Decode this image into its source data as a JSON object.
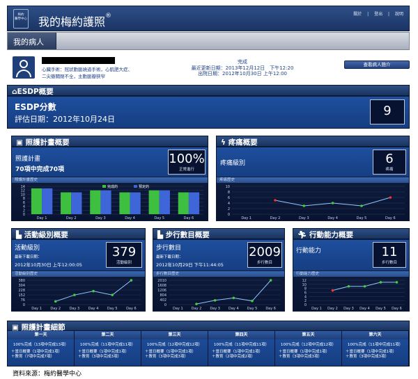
{
  "header": {
    "logo_text": "梅約\n醫學中心",
    "title": "我的梅約護照",
    "links": [
      "關於",
      "登出",
      "說明"
    ]
  },
  "nav": {
    "tab": "我的病人"
  },
  "patient": {
    "diagnosis_line1": "心臟手術：冠狀動脈繞道手術，心肌肥大症、",
    "diagnosis_line2": "二尖瓣關閉不全，主動脈瓣狹窄",
    "status": "完成",
    "last_update": "最近更新日期：2013年12月12日　下午12:20",
    "discharge": "出院日期：2012年10月30日 上午12:00",
    "view_button": "查看病人簡介"
  },
  "esdp": {
    "title": "ESDP概要",
    "score_label": "ESDP分數",
    "date": "評估日期：2012年10月24日",
    "score": "9"
  },
  "care_plan": {
    "title": "照護計畫概要",
    "label": "照護計畫",
    "summary": "70項中完成70項",
    "pct": "100%",
    "pct_caption": "正常進行",
    "history_label": "照護計畫歷史",
    "legend_done": "完成的",
    "legend_planned": "預定的",
    "chart_data": {
      "type": "bar",
      "categories": [
        "Day 1",
        "Day 2",
        "Day 3",
        "Day 4",
        "Day 5",
        "Day 6"
      ],
      "series": [
        {
          "name": "完成的",
          "values": [
            13,
            11,
            12,
            11,
            12,
            11
          ]
        },
        {
          "name": "預定的",
          "values": [
            13,
            11,
            12,
            11,
            12,
            11
          ]
        }
      ],
      "ylim": [
        0,
        14
      ],
      "yticks": [
        "14",
        "12",
        "10",
        "8",
        "6",
        "4",
        "2",
        "0"
      ],
      "colors": [
        "#3fbf3f",
        "#3f66d9"
      ]
    }
  },
  "pain": {
    "title": "疼痛概要",
    "label": "疼痛級別",
    "value": "6",
    "caption": "疼痛",
    "history_label": "疼痛歷史",
    "chart_data": {
      "type": "line",
      "categories": [
        "Day 1",
        "Day 2",
        "Day 3",
        "Day 4",
        "Day 5",
        "Day 6"
      ],
      "values": [
        null,
        5,
        3,
        4,
        3,
        6
      ],
      "ylim": [
        0,
        10
      ],
      "yticks": [
        "10",
        "8",
        "6",
        "4",
        "2",
        "0"
      ]
    }
  },
  "activity": {
    "title": "活動級別概要",
    "label": "活動級別",
    "latest": "最新下載日期：",
    "latest_date": "2012年10月30日 上午12:00:05",
    "value": "379",
    "caption": "活動級別",
    "history_label": "活動級別歷史",
    "chart_data": {
      "type": "line",
      "categories": [
        "Day 1",
        "Day 2",
        "Day 3",
        "Day 4",
        "Day 5",
        "Day 6"
      ],
      "values": [
        null,
        50,
        150,
        210,
        150,
        379
      ],
      "ylim": [
        0,
        380
      ],
      "yticks": [
        "380",
        "304",
        "228",
        "152",
        "76",
        "0"
      ]
    }
  },
  "steps": {
    "title": "步行數目概要",
    "label": "步行數目",
    "latest": "最新下載日期：",
    "latest_date": "2012年10月29日 下午11:44:05",
    "value": "2009",
    "caption": "步行數目",
    "history_label": "步行數目歷史",
    "chart_data": {
      "type": "line",
      "categories": [
        "Day 1",
        "Day 2",
        "Day 3",
        "Day 4",
        "Day 5",
        "Day 6"
      ],
      "values": [
        null,
        50,
        350,
        550,
        300,
        2009
      ],
      "ylim": [
        0,
        2010
      ],
      "yticks": [
        "2010",
        "1608",
        "1206",
        "804",
        "402",
        "0"
      ]
    }
  },
  "mobility": {
    "title": "行動能力概要",
    "label": "行動能力",
    "value": "11",
    "caption": "步行數目",
    "history_label": "行動能力歷史",
    "chart_data": {
      "type": "line",
      "categories": [
        "Day 1",
        "Day 2",
        "Day 3",
        "Day 4",
        "Day 5",
        "Day 6"
      ],
      "values": [
        null,
        7,
        9,
        9,
        11,
        11
      ],
      "ylim": [
        0,
        12
      ],
      "yticks": [
        "12",
        "10",
        "8",
        "6",
        "4",
        "2",
        "0"
      ]
    }
  },
  "details": {
    "title": "照護計畫細節",
    "days": [
      {
        "name": "第一天",
        "summary": "100%完成（13項中完成13項）",
        "l1": "＋當日概要（1項中完成1項）",
        "l2": "＋教育（7項中完成7項）"
      },
      {
        "name": "第二天",
        "summary": "100%完成（11項中完成11項）",
        "l1": "＋當日概要（1項中完成1項）",
        "l2": "＋教育（3項中完成3項）"
      },
      {
        "name": "第三天",
        "summary": "100%完成（12項中完成12項）",
        "l1": "＋當日概要（1項中完成1項）",
        "l2": "＋教育（3項中完成3項）"
      },
      {
        "name": "第四天",
        "summary": "100%完成（11項中完成11項）",
        "l1": "＋當日概要（1項中完成1項）",
        "l2": "＋教育（2項中完成2項）"
      },
      {
        "name": "第五天",
        "summary": "100%完成（12項中完成12項）",
        "l1": "＋當日概要（1項中完成1項）",
        "l2": "＋教育（3項中完成3項）"
      },
      {
        "name": "第六天",
        "summary": "100%完成（11項中完成11項）",
        "l1": "＋當日概要（1項中完成1項）",
        "l2": "＋教育（3項中完成3項）"
      }
    ]
  },
  "source": "資料來源：梅約醫學中心"
}
